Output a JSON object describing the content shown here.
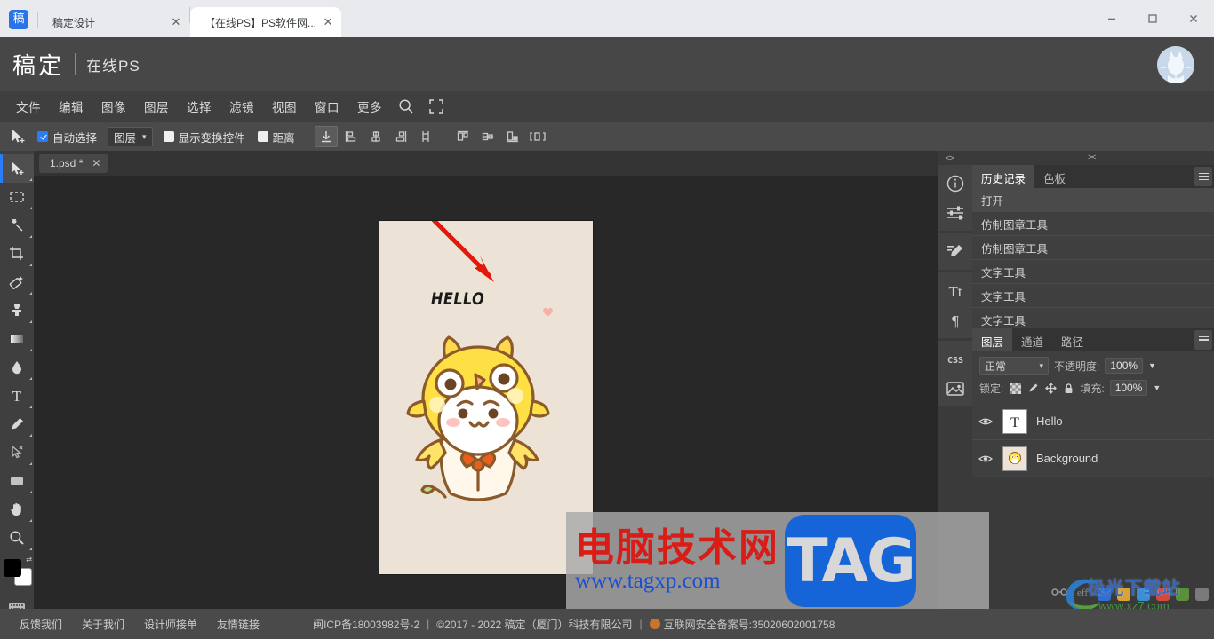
{
  "browser": {
    "brand_chip": "稿",
    "tabs": [
      {
        "label": "稿定设计",
        "active": false,
        "close": "✕"
      },
      {
        "label": "【在线PS】PS软件网...",
        "active": true,
        "close": "✕"
      }
    ],
    "window_controls": {
      "minimize": "minimize-icon",
      "maximize": "maximize-icon",
      "close": "close-icon"
    }
  },
  "app_header": {
    "logo": "稿定",
    "subtitle": "在线PS",
    "avatar": "cat-avatar"
  },
  "menubar": {
    "items": [
      "文件",
      "编辑",
      "图像",
      "图层",
      "选择",
      "滤镜",
      "视图",
      "窗口",
      "更多"
    ],
    "icons": [
      "search-icon",
      "fullscreen-icon"
    ]
  },
  "options_bar": {
    "active_tool_icon": "move-tool-icon",
    "auto_select_label": "自动选择",
    "auto_select_checked": true,
    "target_select_value": "图层",
    "show_transform_label": "显示变换控件",
    "show_transform_checked": false,
    "distance_label": "距离",
    "distance_checked": false,
    "align_buttons": [
      "align-download-icon",
      "align-left-icon",
      "align-center-horizontal-icon",
      "align-right-icon",
      "align-distribute-vertical-icon",
      "align-top-icon",
      "align-middle-icon",
      "align-bottom-icon",
      "distribute-horizontal-icon"
    ]
  },
  "tools": [
    {
      "name": "move-tool",
      "glyph": "move",
      "active": true
    },
    {
      "name": "marquee-tool",
      "glyph": "marquee",
      "active": false
    },
    {
      "name": "magic-wand-tool",
      "glyph": "wand",
      "active": false
    },
    {
      "name": "crop-tool",
      "glyph": "crop",
      "active": false
    },
    {
      "name": "eraser-tool",
      "glyph": "eraser",
      "active": false
    },
    {
      "name": "clone-stamp-tool",
      "glyph": "stamp",
      "active": false
    },
    {
      "name": "gradient-tool",
      "glyph": "gradient",
      "active": false
    },
    {
      "name": "blur-tool",
      "glyph": "drop",
      "active": false
    },
    {
      "name": "type-tool",
      "glyph": "type",
      "active": false
    },
    {
      "name": "pen-tool",
      "glyph": "pen",
      "active": false
    },
    {
      "name": "path-select-tool",
      "glyph": "pathselect",
      "active": false
    },
    {
      "name": "shape-tool",
      "glyph": "rect",
      "active": false
    },
    {
      "name": "hand-tool",
      "glyph": "hand",
      "active": false
    },
    {
      "name": "zoom-tool",
      "glyph": "zoom",
      "active": false
    }
  ],
  "color_swatches": {
    "foreground": "#000000",
    "background": "#ffffff"
  },
  "document": {
    "tab_label": "1.psd *",
    "tab_close": "✕"
  },
  "canvas": {
    "artwork_text": "HELLO",
    "background_color": "#ece2d6",
    "annotation": "red-arrow-pointing-to-hello"
  },
  "right_rail": {
    "collapse_left": "<>",
    "collapse_right": "><",
    "icon_column": [
      "info-icon",
      "adjustments-icon",
      "brush-presets-icon",
      "character-icon",
      "paragraph-icon",
      "css-icon",
      "image-icon"
    ],
    "history_panel": {
      "tabs": [
        {
          "label": "历史记录",
          "active": true
        },
        {
          "label": "色板",
          "active": false
        }
      ],
      "menu_icon": "panel-menu-icon",
      "items": [
        {
          "label": "打开",
          "selected": true
        },
        {
          "label": "仿制图章工具",
          "selected": false
        },
        {
          "label": "仿制图章工具",
          "selected": false
        },
        {
          "label": "文字工具",
          "selected": false
        },
        {
          "label": "文字工具",
          "selected": false
        },
        {
          "label": "文字工具",
          "selected": false
        }
      ]
    },
    "layers_panel": {
      "tabs": [
        {
          "label": "图层",
          "active": true
        },
        {
          "label": "通道",
          "active": false
        },
        {
          "label": "路径",
          "active": false
        }
      ],
      "menu_icon": "panel-menu-icon",
      "blend_mode": "正常",
      "opacity_label": "不透明度:",
      "opacity_value": "100%",
      "lock_label": "锁定:",
      "lock_icons": [
        "lock-transparency-icon",
        "lock-pixels-icon",
        "lock-position-icon",
        "lock-all-icon"
      ],
      "fill_label": "填充:",
      "fill_value": "100%",
      "layers": [
        {
          "name": "Hello",
          "visible": true,
          "thumb": "text-layer-thumb"
        },
        {
          "name": "Background",
          "visible": true,
          "thumb": "image-layer-thumb"
        }
      ]
    }
  },
  "footer": {
    "links": [
      "反馈我们",
      "关于我们",
      "设计师接单",
      "友情链接"
    ],
    "icp": "闽ICP备18003982号-2",
    "separator": "|",
    "copyright": "©2017 - 2022 稿定（厦门）科技有限公司",
    "beian_label": "互联网安全备案号:35020602001758"
  },
  "watermarks": {
    "main_cn": "电脑技术网",
    "main_url": "www.tagxp.com",
    "main_tag": "TAG",
    "corner_cn": "极光下载站",
    "corner_url": "www.xz7.com"
  }
}
